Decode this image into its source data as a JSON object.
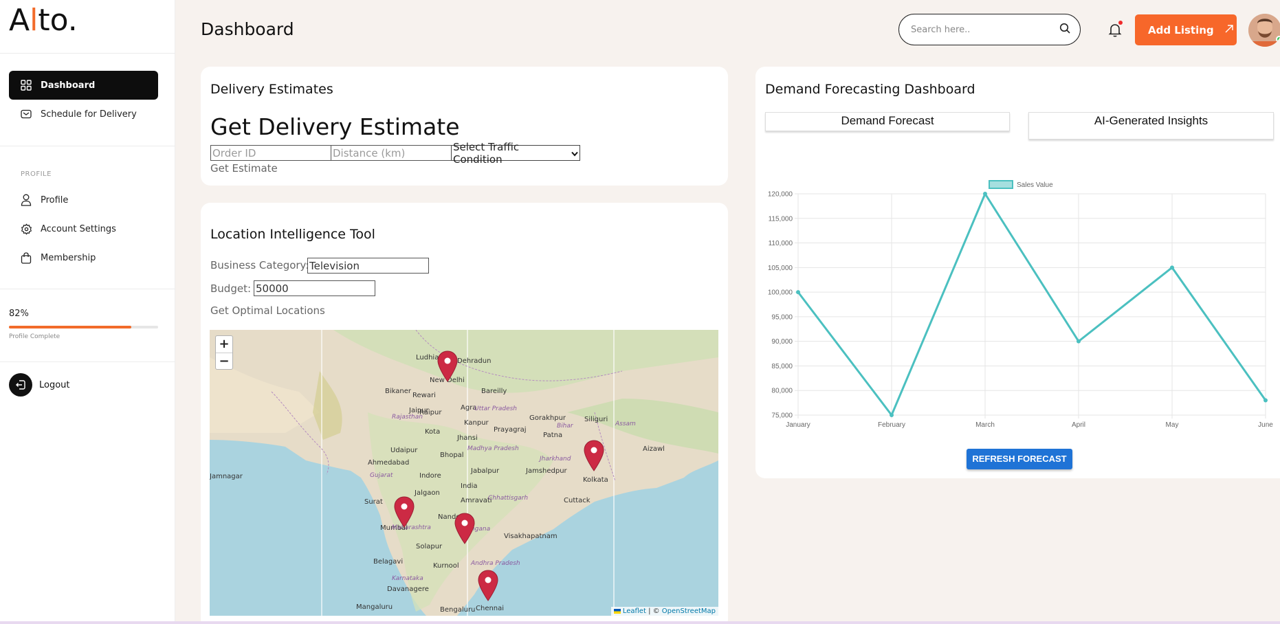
{
  "brand": {
    "logo_pre": "A",
    "logo_accent": "l",
    "logo_post": "to.",
    "accent_color": "#f26b2a"
  },
  "sidebar": {
    "items": [
      {
        "label": "Dashboard",
        "icon": "grid-icon"
      },
      {
        "label": "Schedule for Delivery",
        "icon": "envelope-icon"
      }
    ],
    "profile_section_label": "PROFILE",
    "profile_items": [
      {
        "label": "Profile",
        "icon": "user-icon"
      },
      {
        "label": "Account Settings",
        "icon": "gear-icon"
      },
      {
        "label": "Membership",
        "icon": "bag-icon"
      }
    ],
    "progress": {
      "percent_label": "82%",
      "value": 0.82,
      "caption": "Profile Complete"
    },
    "logout_label": "Logout"
  },
  "header": {
    "title": "Dashboard",
    "search_placeholder": "Search here..",
    "add_listing_label": "Add Listing"
  },
  "delivery": {
    "title": "Delivery Estimates",
    "heading": "Get Delivery Estimate",
    "order_placeholder": "Order ID",
    "distance_placeholder": "Distance (km)",
    "traffic_select": "Select Traffic Condition",
    "get_estimate": "Get Estimate"
  },
  "location": {
    "title": "Location Intelligence Tool",
    "category_label": "Business Category:",
    "category_value": "Television",
    "budget_label": "Budget:",
    "budget_value": "50000",
    "optimal_link": "Get Optimal Locations",
    "map": {
      "zoom_in": "+",
      "zoom_out": "−",
      "attribution_leaflet": "Leaflet",
      "attribution_sep": " | © ",
      "attribution_osm": "OpenStreetMap",
      "cities": [
        "Ludhiana",
        "Dehradun",
        "New Delhi",
        "Bareilly",
        "Bikaner",
        "Jaipur",
        "Agra",
        "Kanpur",
        "Gorakhpur",
        "Siliguri",
        "Kota",
        "Jhansi",
        "Prayagraj",
        "Patna",
        "Udaipur",
        "Bhopal",
        "Ahmedabad",
        "Jabalpur",
        "Jamshedpur",
        "Kolkata",
        "Jamnagar",
        "Indore",
        "Surat",
        "Jalgaon",
        "Amravati",
        "Cuttack",
        "Mumbai",
        "Nanded",
        "Visakhapatnam",
        "Solapur",
        "Belagavi",
        "Kurnool",
        "Davanagere",
        "Mangaluru",
        "Bengaluru",
        "Chennai",
        "Aizawl",
        "Raipur",
        "Rewari",
        "Assam",
        "Uttar Pradesh",
        "Madhya Pradesh",
        "Maharashtra",
        "Telangana",
        "Andhra Pradesh",
        "Karnataka",
        "Gujarat",
        "Rajasthan",
        "Chhattisgarh",
        "Jharkhand",
        "Bihar",
        "India"
      ]
    }
  },
  "forecast": {
    "title": "Demand Forecasting Dashboard",
    "tab_forecast": "Demand Forecast",
    "tab_insights": "AI-Generated Insights",
    "refresh_label": "REFRESH FORECAST"
  },
  "chart_data": {
    "type": "line",
    "categories": [
      "January",
      "February",
      "March",
      "April",
      "May",
      "June"
    ],
    "series": [
      {
        "name": "Sales Value",
        "values": [
          100000,
          75000,
          120000,
          90000,
          105000,
          78000
        ],
        "color": "#4bc0c0"
      }
    ],
    "ylim": [
      75000,
      120000
    ],
    "yticks": [
      "75,000",
      "80,000",
      "85,000",
      "90,000",
      "95,000",
      "100,000",
      "105,000",
      "110,000",
      "115,000",
      "120,000"
    ],
    "grid": true,
    "legend": "top-center"
  }
}
